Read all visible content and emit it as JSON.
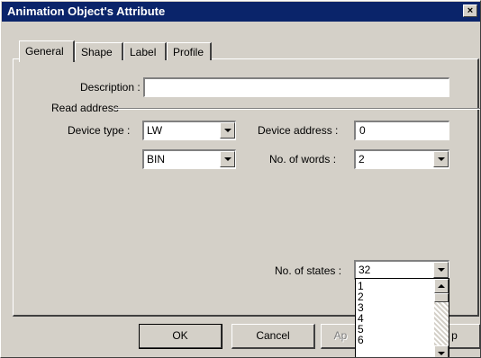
{
  "window": {
    "title": "Animation Object's Attribute",
    "close_label": "×"
  },
  "tabs": [
    {
      "label": "General"
    },
    {
      "label": "Shape"
    },
    {
      "label": "Label"
    },
    {
      "label": "Profile"
    }
  ],
  "form": {
    "description_label": "Description :",
    "description_value": "",
    "read_address_label": "Read address",
    "device_type_label": "Device type :",
    "device_type_value": "LW",
    "format_value": "BIN",
    "device_address_label": "Device address :",
    "device_address_value": "0",
    "no_of_words_label": "No. of words :",
    "no_of_words_value": "2",
    "no_of_states_label": "No. of states :",
    "no_of_states_value": "32"
  },
  "dropdown": {
    "options": [
      "1",
      "2",
      "3",
      "4",
      "5",
      "6"
    ]
  },
  "buttons": {
    "ok": "OK",
    "cancel": "Cancel",
    "apply": "Ap",
    "help": "p"
  }
}
